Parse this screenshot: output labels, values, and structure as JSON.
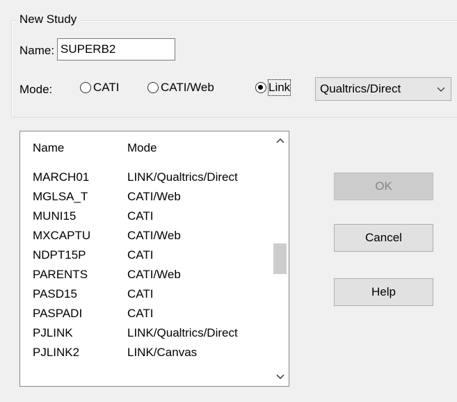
{
  "new_study": {
    "group_title": "New Study",
    "name_label": "Name:",
    "name_value": "SUPERB2",
    "mode_label": "Mode:",
    "mode_options": [
      {
        "label": "CATI",
        "selected": false
      },
      {
        "label": "CATI/Web",
        "selected": false
      },
      {
        "label": "Link",
        "selected": true
      }
    ],
    "link_type_selected": "Qualtrics/Direct"
  },
  "study_list": {
    "columns": [
      "Name",
      "Mode"
    ],
    "rows": [
      {
        "name": "MARCH01",
        "mode": "LINK/Qualtrics/Direct"
      },
      {
        "name": "MGLSA_T",
        "mode": "CATI/Web"
      },
      {
        "name": "MUNI15",
        "mode": "CATI"
      },
      {
        "name": "MXCAPTU",
        "mode": "CATI/Web"
      },
      {
        "name": "NDPT15P",
        "mode": "CATI"
      },
      {
        "name": "PARENTS",
        "mode": "CATI/Web"
      },
      {
        "name": "PASD15",
        "mode": "CATI"
      },
      {
        "name": "PASPADI",
        "mode": "CATI"
      },
      {
        "name": "PJLINK",
        "mode": "LINK/Qualtrics/Direct"
      },
      {
        "name": "PJLINK2",
        "mode": "LINK/Canvas"
      }
    ]
  },
  "buttons": {
    "ok": "OK",
    "cancel": "Cancel",
    "help": "Help"
  },
  "icons": {
    "dropdown": "chevron-down-icon",
    "scroll_up": "chevron-up-icon",
    "scroll_down": "chevron-down-icon"
  },
  "colors": {
    "dialog_bg": "#f0f0f0",
    "button_bg": "#e1e1e1",
    "disabled_button_bg": "#cccccc",
    "scroll_thumb": "#cdcdcd"
  }
}
